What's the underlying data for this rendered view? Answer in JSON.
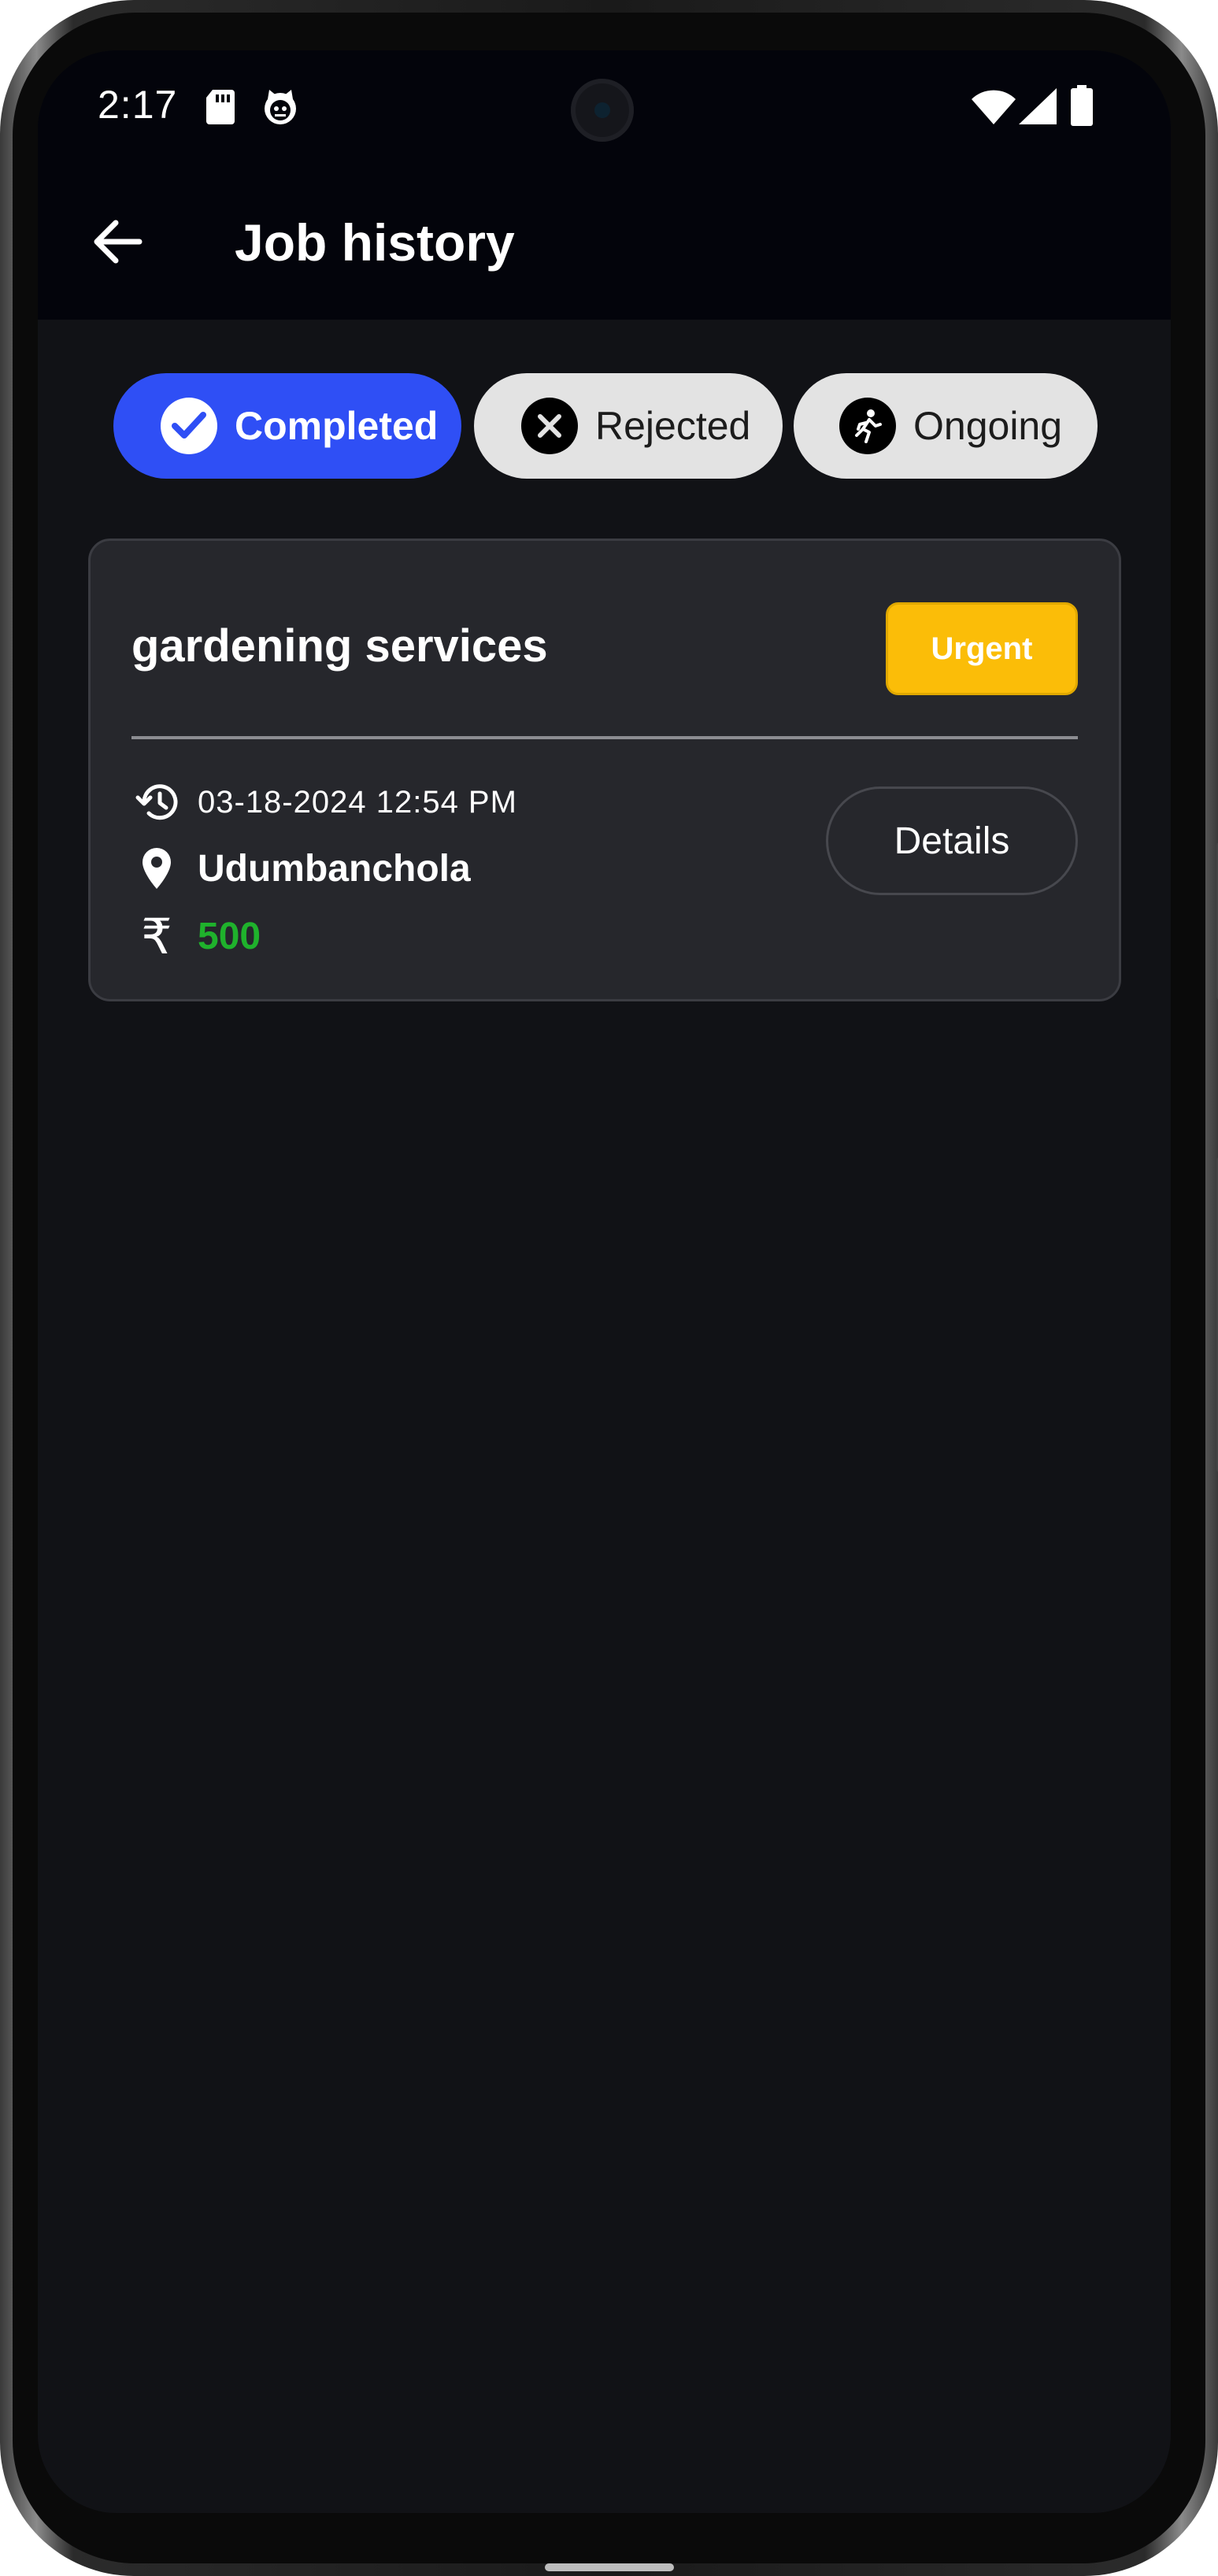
{
  "status_bar": {
    "time": "2:17",
    "left_icons": [
      "sd-card-icon",
      "cat-face-icon"
    ],
    "right_icons": [
      "wifi-icon",
      "signal-icon",
      "battery-icon"
    ]
  },
  "app_bar": {
    "back_icon": "arrow-left-icon",
    "title": "Job history"
  },
  "filters": [
    {
      "label": "Completed",
      "icon": "check-circle-icon",
      "selected": true
    },
    {
      "label": "Rejected",
      "icon": "x-circle-icon",
      "selected": false
    },
    {
      "label": "Ongoing",
      "icon": "running-person-icon",
      "selected": false
    }
  ],
  "jobs": [
    {
      "title": "gardening services",
      "priority": "Urgent",
      "datetime": "03-18-2024 12:54 PM",
      "location": "Udumbanchola",
      "currency_symbol": "₹",
      "amount": "500",
      "details_label": "Details"
    }
  ],
  "colors": {
    "accent": "#2f4ff5",
    "urgent": "#fbbd08",
    "amount": "#1fb22c",
    "background": "#111216",
    "card": "#26272c"
  }
}
